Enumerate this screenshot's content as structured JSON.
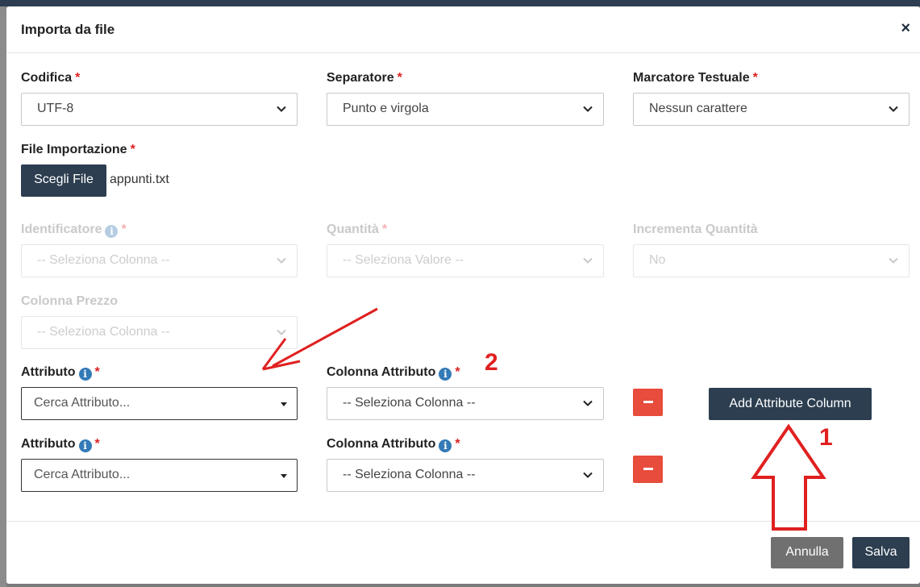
{
  "modal": {
    "title": "Importa da file",
    "close_glyph": "×"
  },
  "fields": {
    "codifica": {
      "label": "Codifica",
      "value": "UTF-8"
    },
    "separatore": {
      "label": "Separatore",
      "value": "Punto e virgola"
    },
    "marcatore": {
      "label": "Marcatore Testuale",
      "value": "Nessun carattere"
    },
    "file": {
      "label": "File Importazione",
      "button": "Scegli File",
      "filename": "appunti.txt"
    },
    "identificatore": {
      "label": "Identificatore",
      "value": "-- Seleziona Colonna --"
    },
    "quantita": {
      "label": "Quantità",
      "value": "-- Seleziona Valore --"
    },
    "incrementa": {
      "label": "Incrementa Quantità",
      "value": "No"
    },
    "prezzo": {
      "label": "Colonna Prezzo",
      "value": "-- Seleziona Colonna --"
    }
  },
  "required_mark": "*",
  "info_glyph": "i",
  "attribute_rows": [
    {
      "attr_label": "Attributo",
      "attr_placeholder": "Cerca Attributo...",
      "col_label": "Colonna Attributo",
      "col_value": "-- Seleziona Colonna --"
    },
    {
      "attr_label": "Attributo",
      "attr_placeholder": "Cerca Attributo...",
      "col_label": "Colonna Attributo",
      "col_value": "-- Seleziona Colonna --"
    }
  ],
  "actions": {
    "add_attribute": "Add Attribute Column",
    "cancel": "Annulla",
    "save": "Salva"
  },
  "annotations": {
    "label_1": "1",
    "label_2": "2",
    "color": "#e02020"
  },
  "colors": {
    "primary": "#2c3e50",
    "danger": "#e74c3c",
    "required": "#dd2222",
    "info": "#337ab7",
    "cancel": "#707070"
  }
}
